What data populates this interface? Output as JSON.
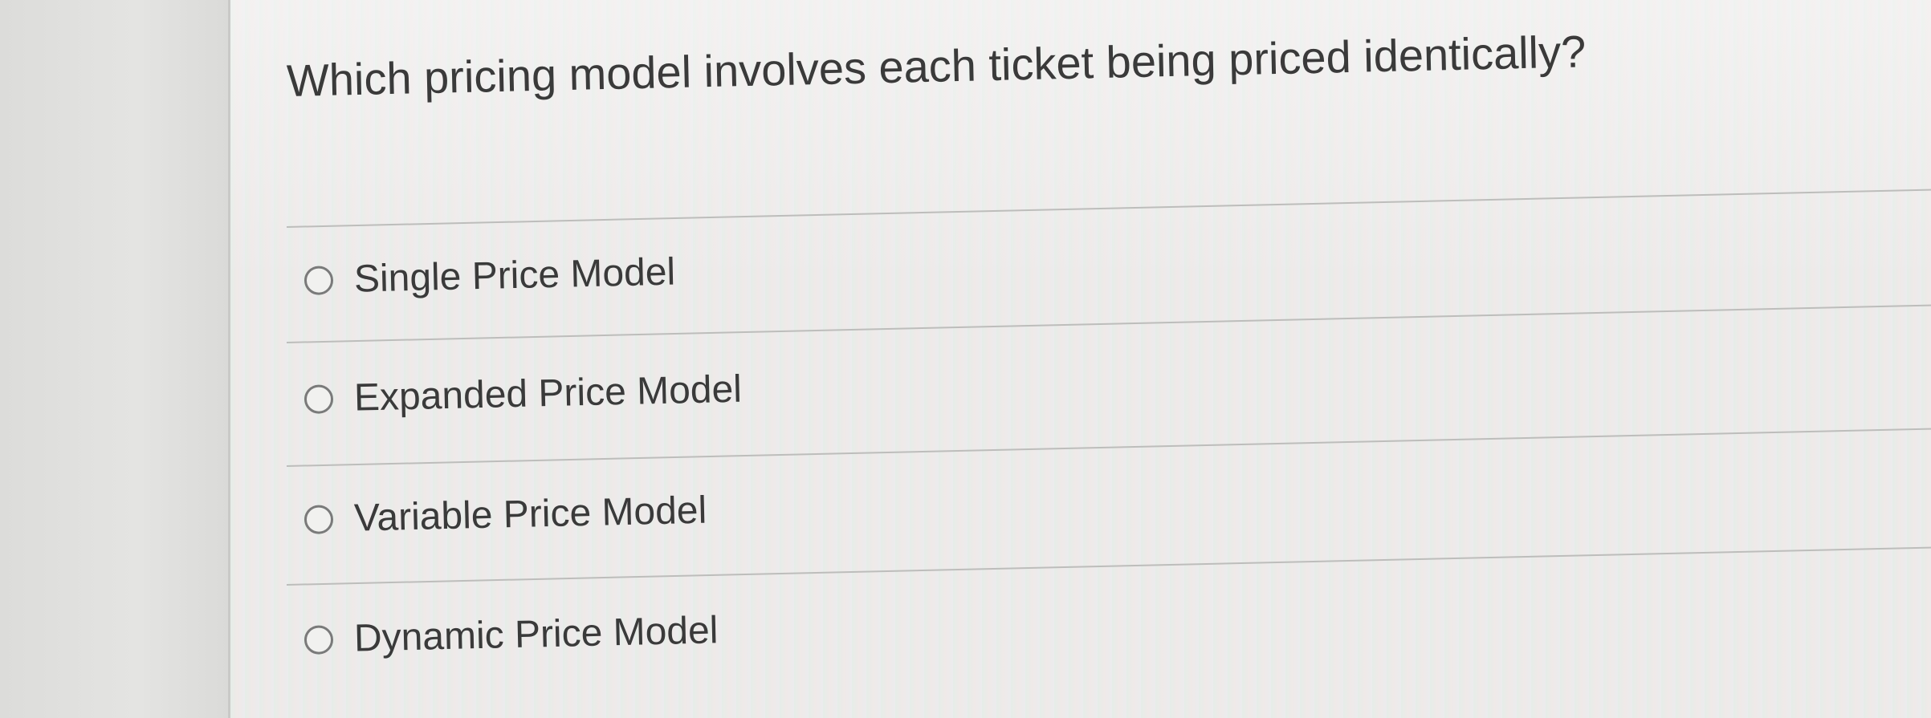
{
  "question": {
    "text": "Which pricing model involves each ticket being priced identically?"
  },
  "options": [
    {
      "label": "Single Price Model",
      "selected": false
    },
    {
      "label": "Expanded Price Model",
      "selected": false
    },
    {
      "label": "Variable Price Model",
      "selected": false
    },
    {
      "label": "Dynamic Price Model",
      "selected": false
    }
  ],
  "icons": {
    "radio": "radio-empty-icon"
  }
}
